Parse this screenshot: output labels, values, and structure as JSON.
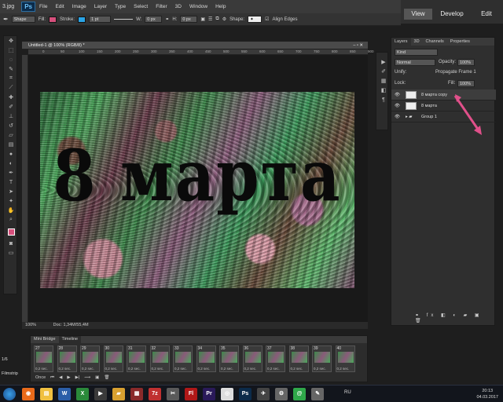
{
  "menubar": {
    "file_tag": "3.jpg",
    "app_badge": "Ps",
    "items": [
      "File",
      "Edit",
      "Image",
      "Layer",
      "Type",
      "Select",
      "Filter",
      "3D",
      "Window",
      "Help"
    ]
  },
  "options": {
    "mode": "Shape",
    "fill_label": "Fill:",
    "stroke_label": "Stroke:",
    "stroke_width": "1 pt",
    "w_label": "W:",
    "w_value": "0 px",
    "h_label": "H:",
    "h_value": "0 px",
    "shape_label": "Shape:",
    "align_edges": "Align Edges",
    "fill_color": "#d6507c",
    "stroke_color": "#2aa4e6"
  },
  "workspace": {
    "view": "View",
    "develop": "Develop",
    "edit": "Edit",
    "sub_develop": "Develop",
    "sub_edit": "Edit"
  },
  "tools": [
    "move-icon",
    "marquee-icon",
    "lasso-icon",
    "quick-select-icon",
    "crop-icon",
    "eyedropper-icon",
    "healing-icon",
    "brush-icon",
    "stamp-icon",
    "history-brush-icon",
    "eraser-icon",
    "gradient-icon",
    "blur-icon",
    "dodge-icon",
    "pen-icon",
    "type-icon",
    "path-select-icon",
    "shape-icon",
    "hand-icon",
    "zoom-icon"
  ],
  "document": {
    "tab_title": "Untitled-1 @ 100% (RGB/8) *",
    "ruler_ticks": [
      "0",
      "50",
      "100",
      "150",
      "200",
      "250",
      "300",
      "350",
      "400",
      "450",
      "500",
      "550",
      "600",
      "650",
      "700",
      "750",
      "800",
      "850",
      "900"
    ],
    "art_text": "8 марта",
    "zoom": "100%",
    "doc_info": "Doc: 1,34M/55,4M"
  },
  "timeline": {
    "tabs": [
      "Mini Bridge",
      "Timeline"
    ],
    "frames": [
      {
        "n": "27",
        "d": "0,2 sec."
      },
      {
        "n": "28",
        "d": "0,2 sec."
      },
      {
        "n": "29",
        "d": "0,2 sec."
      },
      {
        "n": "30",
        "d": "0,2 sec."
      },
      {
        "n": "31",
        "d": "0,2 sec."
      },
      {
        "n": "32",
        "d": "0,2 sec."
      },
      {
        "n": "33",
        "d": "0,2 sec."
      },
      {
        "n": "34",
        "d": "0,2 sec."
      },
      {
        "n": "35",
        "d": "0,2 sec."
      },
      {
        "n": "36",
        "d": "0,2 sec."
      },
      {
        "n": "37",
        "d": "0,2 sec."
      },
      {
        "n": "38",
        "d": "0,2 sec."
      },
      {
        "n": "39",
        "d": "0,2 sec."
      },
      {
        "n": "40",
        "d": "0,2 sec."
      }
    ],
    "loop": "Once",
    "frame_counter": "1/6",
    "filmstrip": "Filmstrip"
  },
  "layers": {
    "tabs": [
      "Layers",
      "3D",
      "Channels",
      "Properties"
    ],
    "kind": "Kind",
    "blend": "Normal",
    "opacity_label": "Opacity:",
    "opacity": "100%",
    "unify_label": "Unify:",
    "propagate": "Propagate Frame 1",
    "lock_label": "Lock:",
    "fill_label": "Fill:",
    "fill": "100%",
    "rows": [
      {
        "name": "8 марта copy"
      },
      {
        "name": "8 марта"
      },
      {
        "name": "Group 1"
      }
    ]
  },
  "taskbar": {
    "lang": "RU",
    "time": "20:13",
    "date": "04.03.2017",
    "apps": [
      "firefox-icon",
      "explorer-icon",
      "word-icon",
      "excel-icon",
      "media-icon",
      "folder-icon",
      "archive-icon",
      "7z-icon",
      "tools-icon",
      "flash-icon",
      "premiere-icon",
      "camera-icon",
      "photoshop-icon",
      "bird-icon",
      "settings-icon",
      "icq-icon",
      "paint-icon"
    ]
  }
}
